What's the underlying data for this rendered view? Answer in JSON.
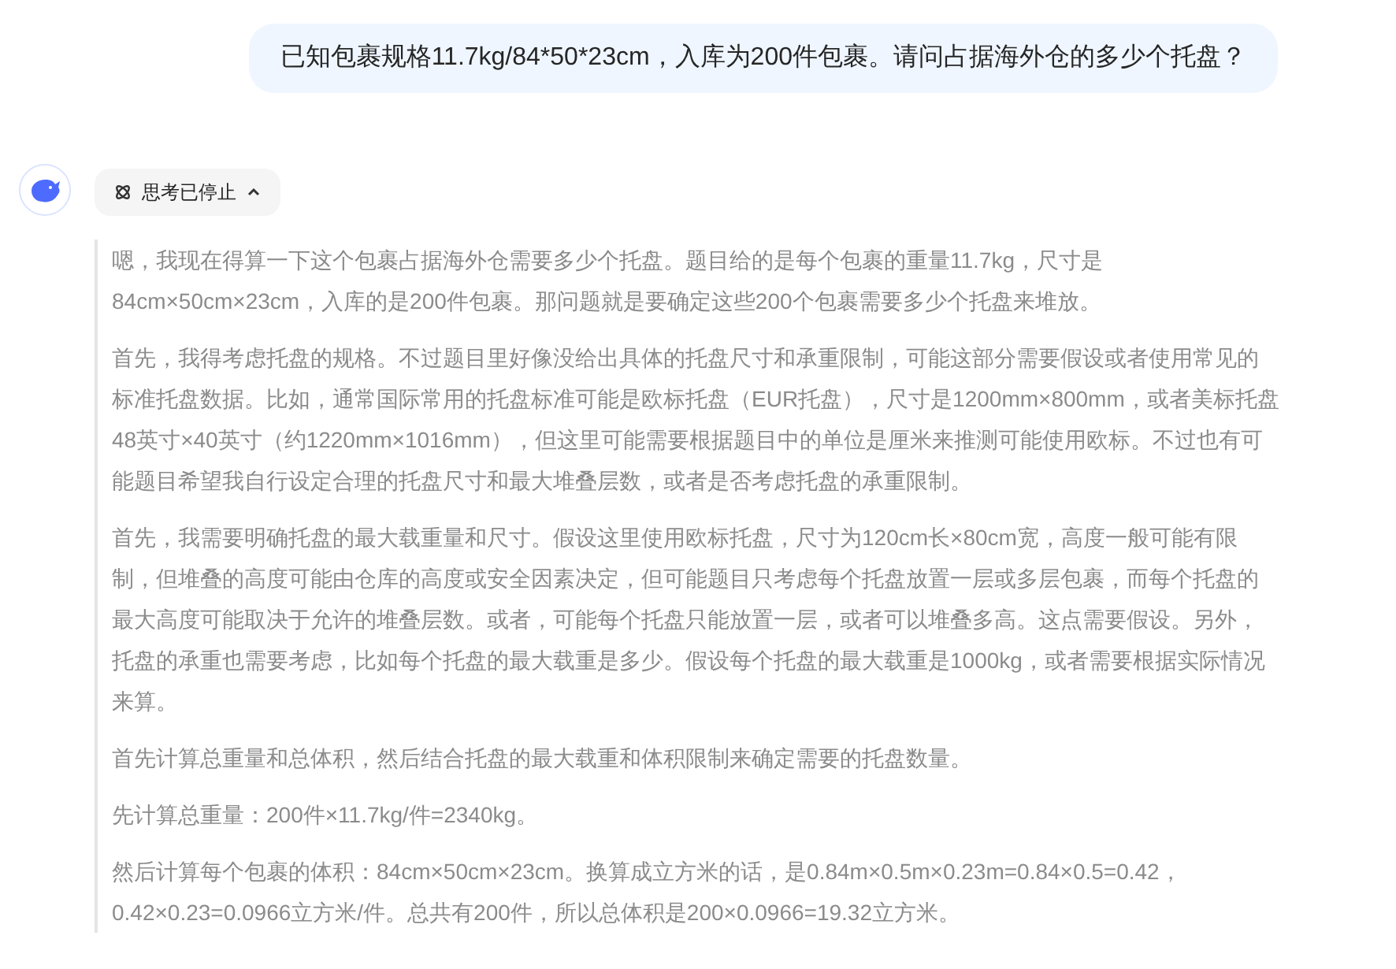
{
  "user_message": "已知包裹规格11.7kg/84*50*23cm，入库为200件包裹。请问占据海外仓的多少个托盘？",
  "thinking_toggle": {
    "label": "思考已停止",
    "expanded": true
  },
  "thinking_paragraphs": [
    "嗯，我现在得算一下这个包裹占据海外仓需要多少个托盘。题目给的是每个包裹的重量11.7kg，尺寸是84cm×50cm×23cm，入库的是200件包裹。那问题就是要确定这些200个包裹需要多少个托盘来堆放。",
    "首先，我得考虑托盘的规格。不过题目里好像没给出具体的托盘尺寸和承重限制，可能这部分需要假设或者使用常见的标准托盘数据。比如，通常国际常用的托盘标准可能是欧标托盘（EUR托盘），尺寸是1200mm×800mm，或者美标托盘48英寸×40英寸（约1220mm×1016mm），但这里可能需要根据题目中的单位是厘米来推测可能使用欧标。不过也有可能题目希望我自行设定合理的托盘尺寸和最大堆叠层数，或者是否考虑托盘的承重限制。",
    "首先，我需要明确托盘的最大载重量和尺寸。假设这里使用欧标托盘，尺寸为120cm长×80cm宽，高度一般可能有限制，但堆叠的高度可能由仓库的高度或安全因素决定，但可能题目只考虑每个托盘放置一层或多层包裹，而每个托盘的最大高度可能取决于允许的堆叠层数。或者，可能每个托盘只能放置一层，或者可以堆叠多高。这点需要假设。另外，托盘的承重也需要考虑，比如每个托盘的最大载重是多少。假设每个托盘的最大载重是1000kg，或者需要根据实际情况来算。",
    "首先计算总重量和总体积，然后结合托盘的最大载重和体积限制来确定需要的托盘数量。",
    "先计算总重量：200件×11.7kg/件=2340kg。",
    "然后计算每个包裹的体积：84cm×50cm×23cm。换算成立方米的话，是0.84m×0.5m×0.23m=0.84×0.5=0.42，0.42×0.23=0.0966立方米/件。总共有200件，所以总体积是200×0.0966=19.32立方米。"
  ]
}
